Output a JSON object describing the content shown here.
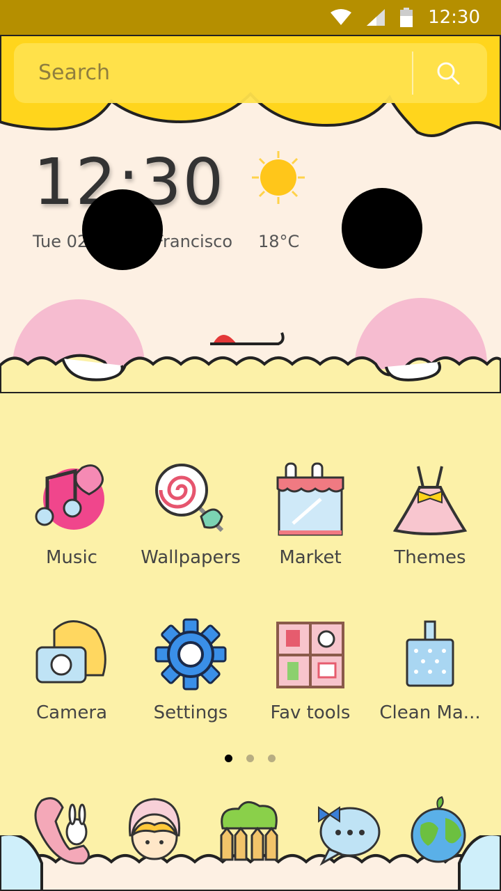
{
  "status_bar": {
    "time": "12:30"
  },
  "search": {
    "placeholder": "Search"
  },
  "clock_widget": {
    "time": "12:30",
    "date": "Tue  02",
    "city": "Francisco",
    "temperature": "18°C",
    "weather_icon": "sun-icon"
  },
  "apps": [
    {
      "label": "Music",
      "icon": "music-icon"
    },
    {
      "label": "Wallpapers",
      "icon": "lollipop-icon"
    },
    {
      "label": "Market",
      "icon": "market-icon"
    },
    {
      "label": "Themes",
      "icon": "dress-icon"
    },
    {
      "label": "Camera",
      "icon": "camera-icon"
    },
    {
      "label": "Settings",
      "icon": "gear-icon"
    },
    {
      "label": "Fav tools",
      "icon": "tools-icon"
    },
    {
      "label": "Clean Ma...",
      "icon": "broom-icon"
    }
  ],
  "pager": {
    "pages": 3,
    "current": 1
  },
  "dock": [
    {
      "icon": "phone-icon"
    },
    {
      "icon": "contacts-icon"
    },
    {
      "icon": "browser-icon"
    },
    {
      "icon": "messages-icon"
    },
    {
      "icon": "globe-icon"
    }
  ],
  "colors": {
    "status_bar": "#b58f00",
    "hair": "#ffd51c",
    "face": "#fdf0e3",
    "body": "#fcf1a8"
  }
}
